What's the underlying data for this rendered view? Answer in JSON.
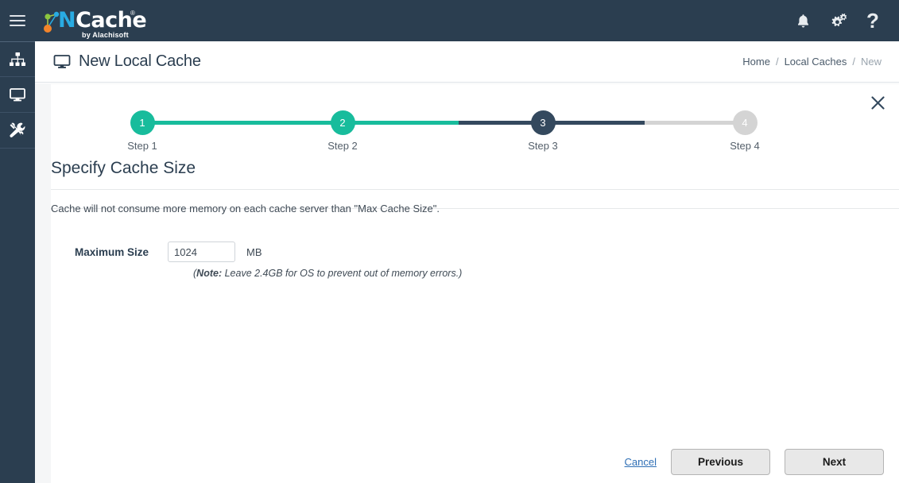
{
  "topbar": {
    "menu_icon": "hamburger-icon",
    "brand_n": "N",
    "brand_cache": "Cache",
    "brand_reg": "®",
    "brand_byline": "by Alachisoft",
    "icons": [
      {
        "name": "notifications-icon",
        "glyph": "bell"
      },
      {
        "name": "settings-icon",
        "glyph": "gears"
      },
      {
        "name": "help-icon",
        "glyph": "?"
      }
    ]
  },
  "sidebar": {
    "items": [
      {
        "name": "sidebar-item-cluster",
        "icon": "sitemap-icon"
      },
      {
        "name": "sidebar-item-monitor",
        "icon": "monitor-icon"
      },
      {
        "name": "sidebar-item-tools",
        "icon": "tools-icon"
      }
    ]
  },
  "page": {
    "title": "New Local Cache",
    "title_icon": "monitor-icon",
    "breadcrumb": [
      {
        "label": "Home",
        "current": false
      },
      {
        "label": "Local Caches",
        "current": false
      },
      {
        "label": "New",
        "current": true
      }
    ],
    "breadcrumb_separator": "/"
  },
  "wizard": {
    "close_label": "✕",
    "steps": [
      {
        "number": "1",
        "label": "Step 1",
        "state": "done"
      },
      {
        "number": "2",
        "label": "Step 2",
        "state": "done"
      },
      {
        "number": "3",
        "label": "Step 3",
        "state": "current"
      },
      {
        "number": "4",
        "label": "Step 4",
        "state": "todo"
      }
    ],
    "heading": "Specify Cache Size",
    "description": "Cache will not consume more memory on each cache server than \"Max Cache Size\".",
    "form": {
      "maximum_size_label": "Maximum Size",
      "maximum_size_value": "1024",
      "maximum_size_placeholder": "1024",
      "unit": "MB",
      "note_prefix": "(",
      "note_bold": "Note:",
      "note_text": " Leave 2.4GB for OS to prevent out of memory errors.)"
    },
    "actions": {
      "cancel": "Cancel",
      "previous": "Previous",
      "next": "Next"
    }
  },
  "colors": {
    "navy": "#2b3e50",
    "step_done": "#18bc9c",
    "step_current": "#34495e",
    "step_todo": "#d4d4d4",
    "link": "#2f6fb5",
    "brand_blue": "#29abe2"
  }
}
